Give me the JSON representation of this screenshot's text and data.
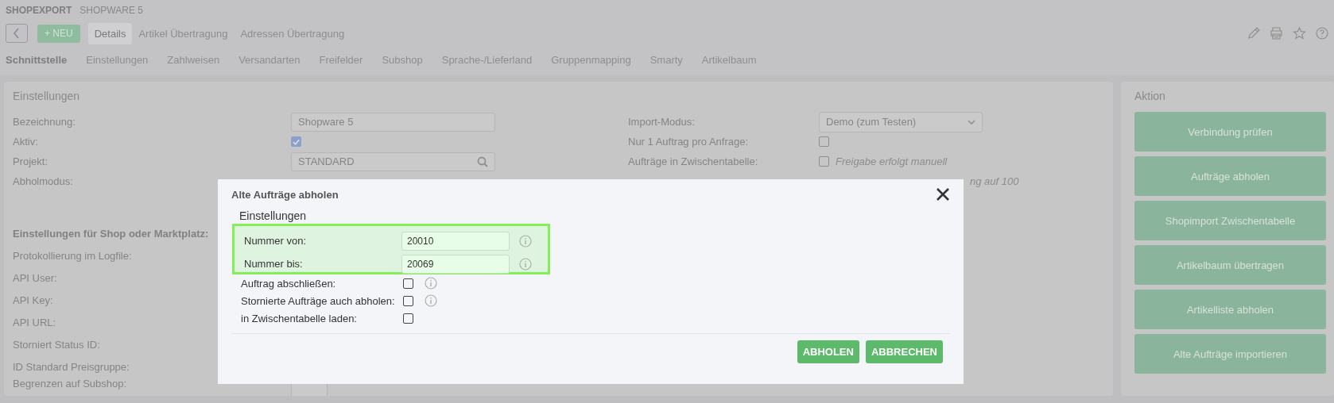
{
  "header": {
    "title": "SHOPEXPORT",
    "subtitle": "SHOPWARE 5"
  },
  "toolbar": {
    "new_button": "+ NEU",
    "tabs": [
      {
        "label": "Details",
        "selected": true
      },
      {
        "label": "Artikel Übertragung",
        "selected": false
      },
      {
        "label": "Adressen Übertragung",
        "selected": false
      }
    ]
  },
  "subtabs": [
    {
      "label": "Schnittstelle",
      "selected": true
    },
    {
      "label": "Einstellungen",
      "selected": false
    },
    {
      "label": "Zahlweisen",
      "selected": false
    },
    {
      "label": "Versandarten",
      "selected": false
    },
    {
      "label": "Freifelder",
      "selected": false
    },
    {
      "label": "Subshop",
      "selected": false
    },
    {
      "label": "Sprache-/Lieferland",
      "selected": false
    },
    {
      "label": "Gruppenmapping",
      "selected": false
    },
    {
      "label": "Smarty",
      "selected": false
    },
    {
      "label": "Artikelbaum",
      "selected": false
    }
  ],
  "settings": {
    "title": "Einstellungen",
    "left_rows": [
      {
        "kind": "text",
        "label": "Bezeichnung:",
        "value": "Shopware 5"
      },
      {
        "kind": "checkbox",
        "label": "Aktiv:",
        "checked": true
      },
      {
        "kind": "search",
        "label": "Projekt:",
        "value": "STANDARD"
      },
      {
        "kind": "block",
        "label": "Abholmodus:"
      },
      {
        "kind": "heading",
        "label": "Einstellungen für Shop oder Marktplatz:"
      },
      {
        "kind": "label",
        "label": "Protokollierung im Logfile:"
      },
      {
        "kind": "label",
        "label": "API User:"
      },
      {
        "kind": "label",
        "label": "API Key:"
      },
      {
        "kind": "label",
        "label": "API URL:"
      },
      {
        "kind": "label",
        "label": "Storniert Status ID:"
      },
      {
        "kind": "label",
        "label": "ID Standard Preisgruppe:"
      },
      {
        "kind": "small_field",
        "label": "Begrenzen auf Subshop:"
      }
    ],
    "right_rows": [
      {
        "kind": "select",
        "label": "Import-Modus:",
        "value": "Demo (zum Testen)"
      },
      {
        "kind": "checkbox",
        "label": "Nur 1 Auftrag pro Anfrage:",
        "checked": false
      },
      {
        "kind": "checkbox",
        "label": "Aufträge in Zwischentabelle:",
        "checked": false,
        "note": "Freigabe erfolgt manuell"
      },
      {
        "kind": "note",
        "note": "ng auf 100"
      }
    ]
  },
  "actions": {
    "title": "Aktion",
    "buttons": [
      "Verbindung prüfen",
      "Aufträge abholen",
      "Shopimport Zwischentabelle",
      "Artikelbaum übertragen",
      "Artikelliste abholen",
      "Alte Aufträge importieren"
    ]
  },
  "dialog": {
    "title": "Alte Aufträge abholen",
    "section": "Einstellungen",
    "highlighted_fields": [
      {
        "kind": "text",
        "label": "Nummer von:",
        "value": "20010",
        "info": true
      },
      {
        "kind": "text",
        "label": "Nummer bis:",
        "value": "20069",
        "info": true
      }
    ],
    "fields": [
      {
        "kind": "checkbox",
        "label": "Auftrag abschließen:",
        "checked": false,
        "info": true
      },
      {
        "kind": "checkbox",
        "label": "Stornierte Aufträge auch abholen:",
        "checked": false,
        "info": true
      },
      {
        "kind": "checkbox",
        "label": "in Zwischentabelle laden:",
        "checked": false,
        "info": false
      }
    ],
    "buttons": [
      "ABHOLEN",
      "ABBRECHEN"
    ]
  }
}
